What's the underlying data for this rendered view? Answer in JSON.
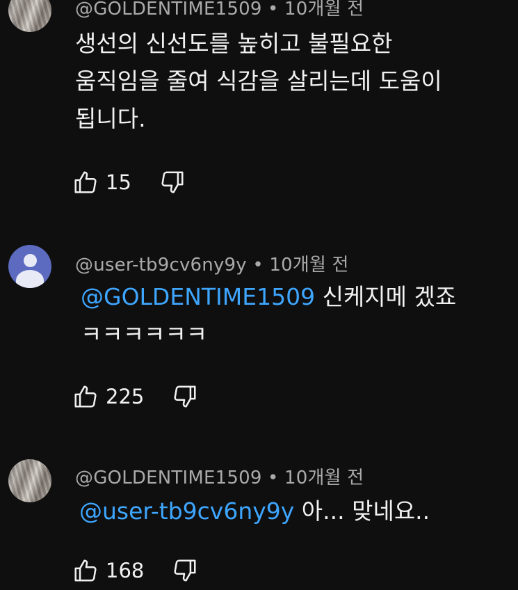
{
  "comments": [
    {
      "author": "@GOLDENTIME1509",
      "time": "10개월 전",
      "text": "생선의 신선도를 높히고 불필요한\n움직임을 줄여 식감을 살리는데 도움이\n됩니다.",
      "mention": "",
      "likes": "15",
      "avatar": "photo"
    },
    {
      "author": "@user-tb9cv6ny9y",
      "time": "10개월 전",
      "mention": "@GOLDENTIME1509",
      "text": " 신케지메 겠죠\nㅋㅋㅋㅋㅋㅋ",
      "likes": "225",
      "avatar": "default"
    },
    {
      "author": "@GOLDENTIME1509",
      "time": "10개월 전",
      "mention": "@user-tb9cv6ny9y",
      "text": " 아... 맞네요..",
      "likes": "168",
      "avatar": "photo"
    }
  ],
  "meta_separator": " • ",
  "icons": {
    "like": "thumb-up-icon",
    "dislike": "thumb-down-icon"
  }
}
